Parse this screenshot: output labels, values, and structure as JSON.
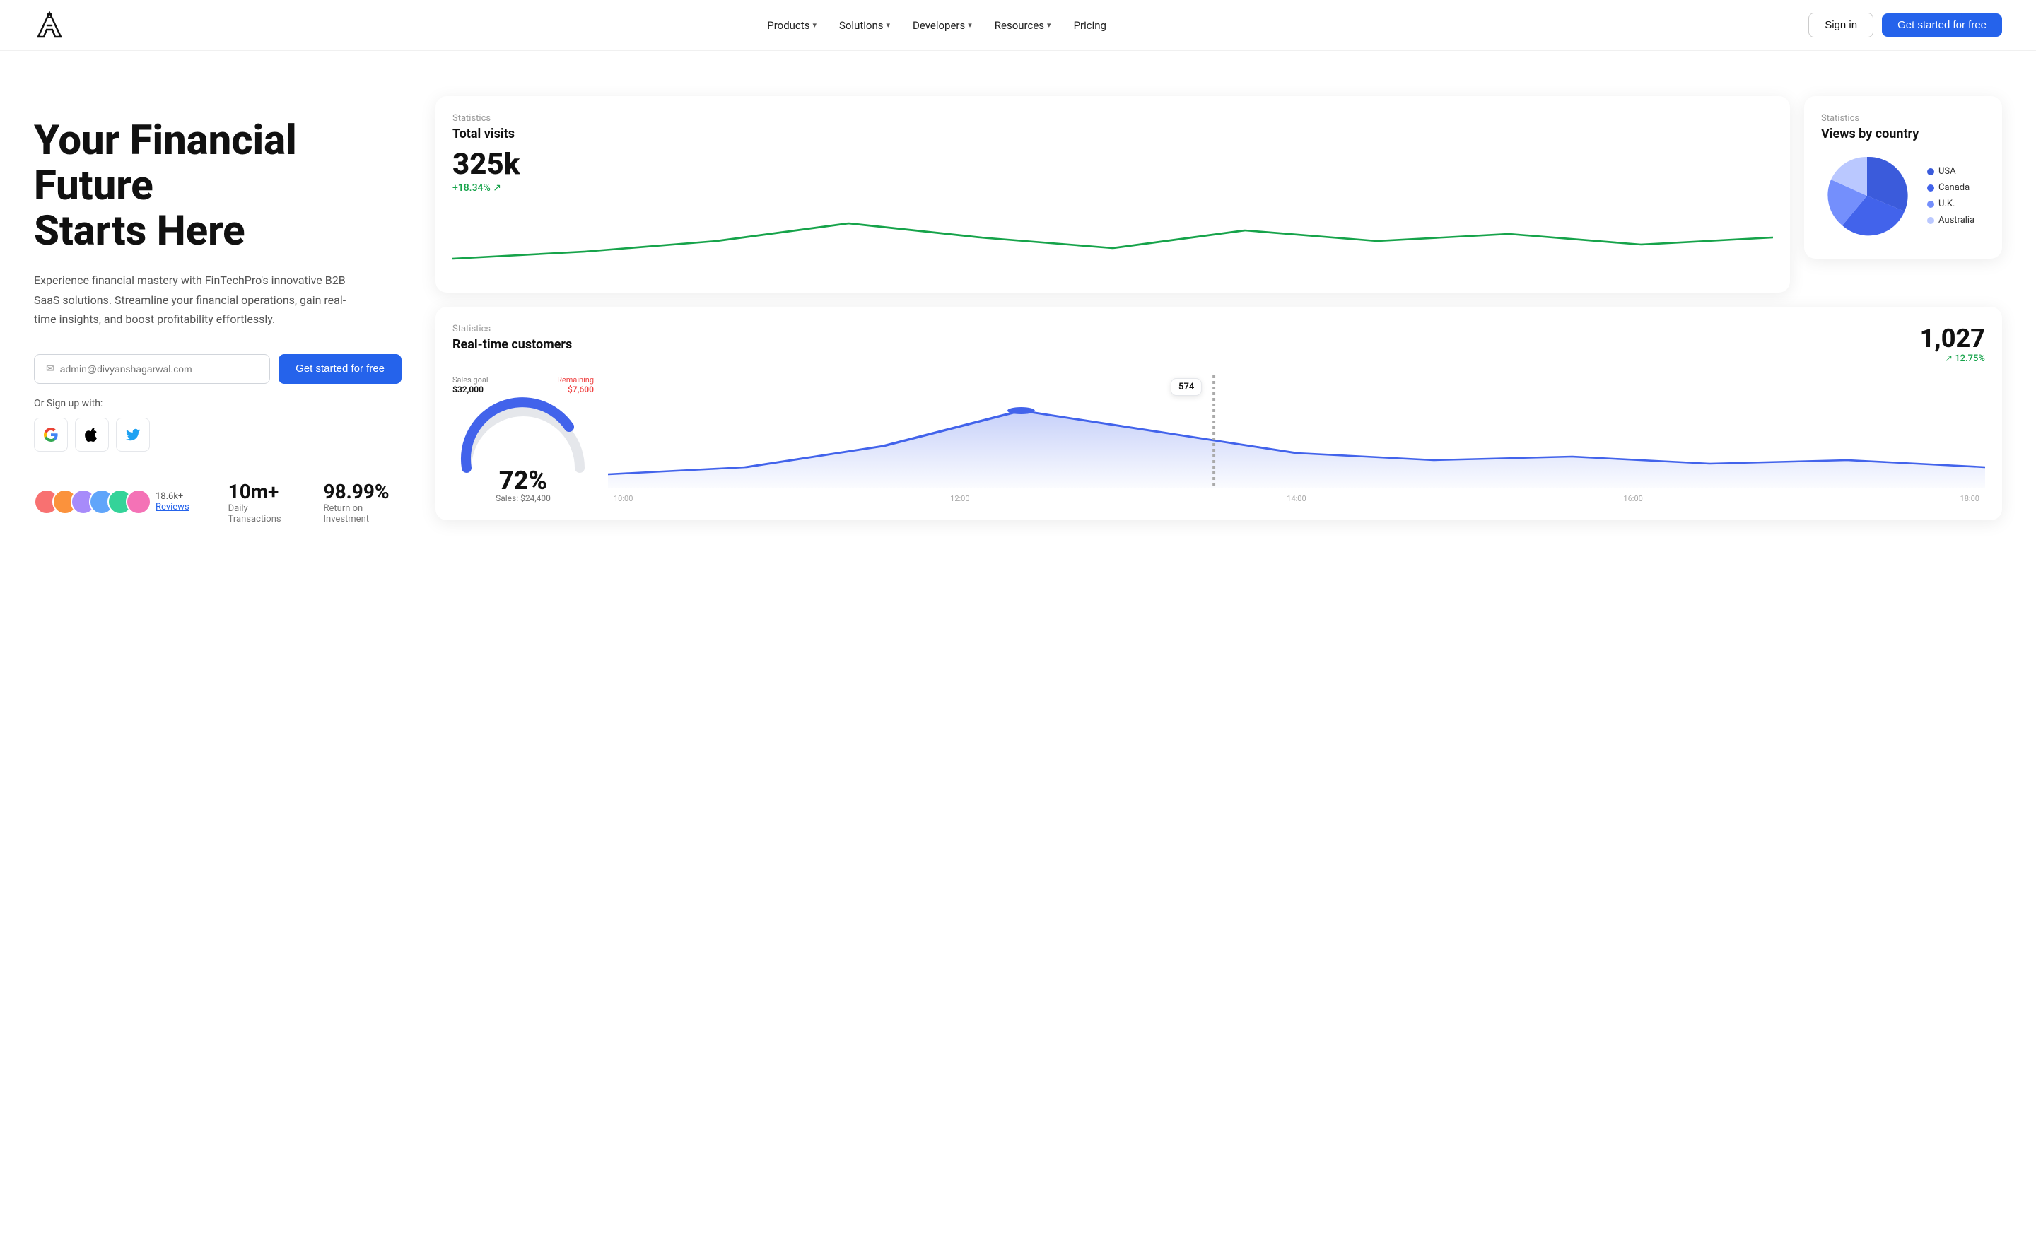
{
  "nav": {
    "logo_text": "A",
    "links": [
      {
        "label": "Products",
        "has_dropdown": true
      },
      {
        "label": "Solutions",
        "has_dropdown": true
      },
      {
        "label": "Developers",
        "has_dropdown": true
      },
      {
        "label": "Resources",
        "has_dropdown": true
      },
      {
        "label": "Pricing",
        "has_dropdown": false
      }
    ],
    "signin_label": "Sign in",
    "getstarted_label": "Get started for free"
  },
  "hero": {
    "title_line1": "Your Financial Future",
    "title_line2": "Starts Here",
    "subtitle": "Experience financial mastery with FinTechPro's innovative B2B SaaS solutions. Streamline your financial operations, gain real-time insights, and boost profitability effortlessly.",
    "email_placeholder": "admin@divyanshagarwal.com",
    "email_icon": "✉",
    "cta_label": "Get started for free",
    "signup_with_label": "Or Sign up with:",
    "social_buttons": [
      {
        "label": "G",
        "name": "google"
      },
      {
        "label": "🍎",
        "name": "apple"
      },
      {
        "label": "🐦",
        "name": "twitter"
      }
    ],
    "reviews_count": "18.6k+",
    "reviews_label": "Reviews",
    "stats": [
      {
        "value": "10m+",
        "label": "Daily Transactions"
      },
      {
        "value": "98.99%",
        "label": "Return on Investment"
      }
    ]
  },
  "card_visits": {
    "section_label": "Statistics",
    "title": "Total visits",
    "value": "325k",
    "change": "+18.34% ↗"
  },
  "card_country": {
    "section_label": "Statistics",
    "title": "Views by country",
    "legend": [
      {
        "label": "USA",
        "color": "#3b5bdb"
      },
      {
        "label": "Canada",
        "color": "#4263eb"
      },
      {
        "label": "U.K.",
        "color": "#748ffc"
      },
      {
        "label": "Australia",
        "color": "#bac8ff"
      }
    ]
  },
  "card_realtime": {
    "section_label": "Statistics",
    "title": "Real-time customers",
    "count": "1,027",
    "change": "↗ 12.75%",
    "sales_goal_label": "Sales goal",
    "sales_goal_value": "$32,000",
    "remaining_label": "Remaining",
    "remaining_value": "$7,600",
    "gauge_pct": "72%",
    "gauge_sub": "Sales: $24,400",
    "tooltip_value": "574",
    "x_axis": [
      "10:00",
      "12:00",
      "14:00",
      "16:00",
      "18:00"
    ]
  }
}
